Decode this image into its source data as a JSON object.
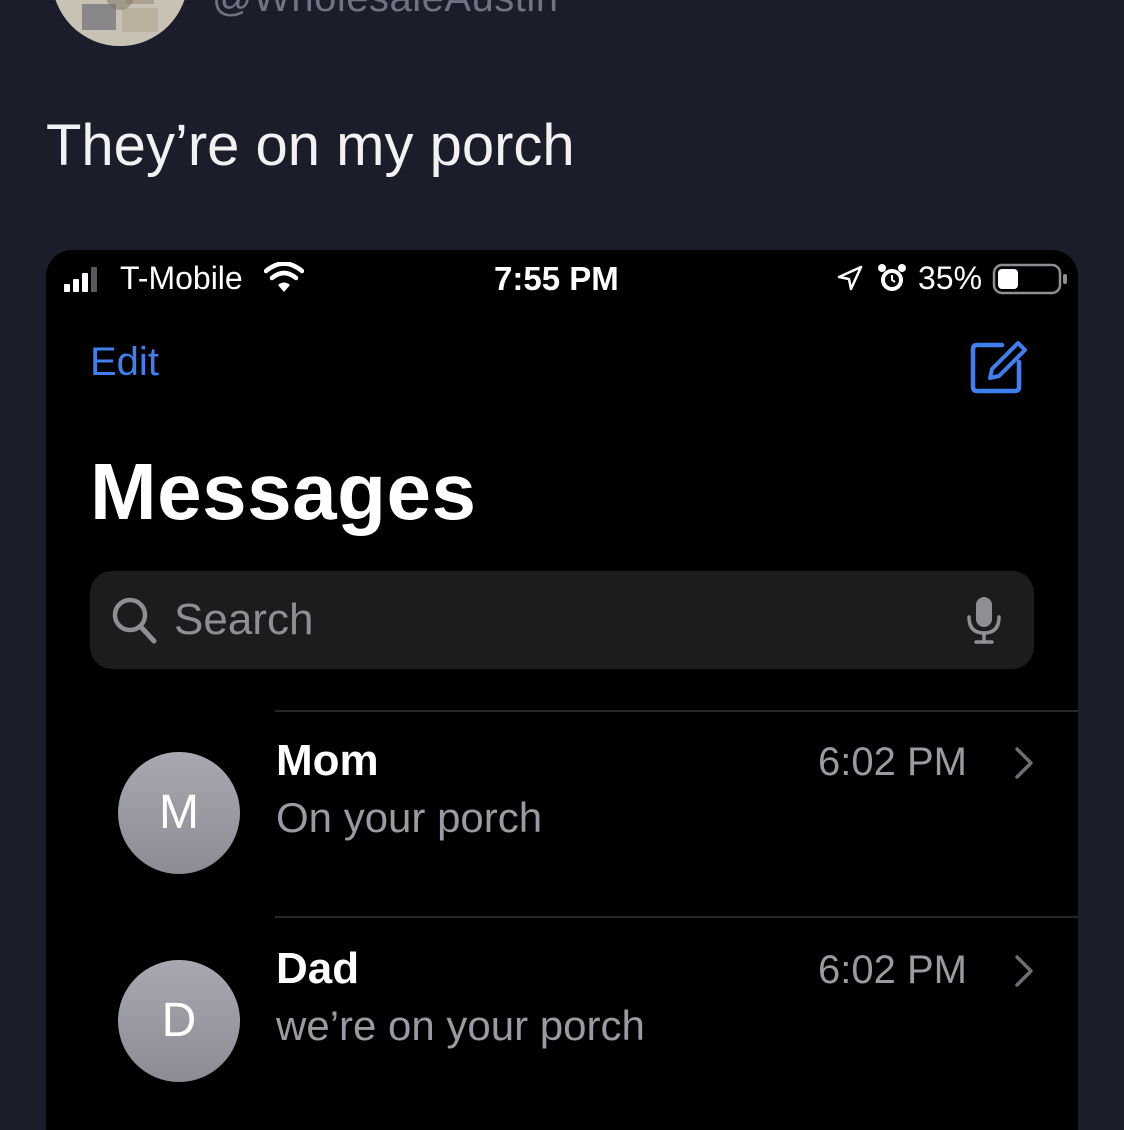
{
  "tweet": {
    "handle": "@WholesaleAustin",
    "text": "They’re on my porch"
  },
  "status_bar": {
    "carrier": "T-Mobile",
    "time": "7:55 PM",
    "battery_percent": "35%",
    "battery_level": 0.35,
    "icons": [
      "signal-icon",
      "wifi-icon",
      "location-icon",
      "alarm-icon",
      "battery-icon"
    ]
  },
  "nav": {
    "edit_label": "Edit",
    "compose_icon": "compose-icon"
  },
  "page": {
    "title": "Messages"
  },
  "search": {
    "placeholder": "Search",
    "value": "",
    "icons": [
      "search-icon",
      "mic-icon"
    ]
  },
  "conversations": [
    {
      "initial": "M",
      "name": "Mom",
      "preview": "On your porch",
      "time": "6:02 PM"
    },
    {
      "initial": "D",
      "name": "Dad",
      "preview": "we’re on your porch",
      "time": "6:02 PM"
    }
  ],
  "colors": {
    "tweet_background": "#1b1d2a",
    "phone_background": "#000000",
    "accent": "#3f7ff0",
    "secondary_text": "#9a9aa0"
  }
}
